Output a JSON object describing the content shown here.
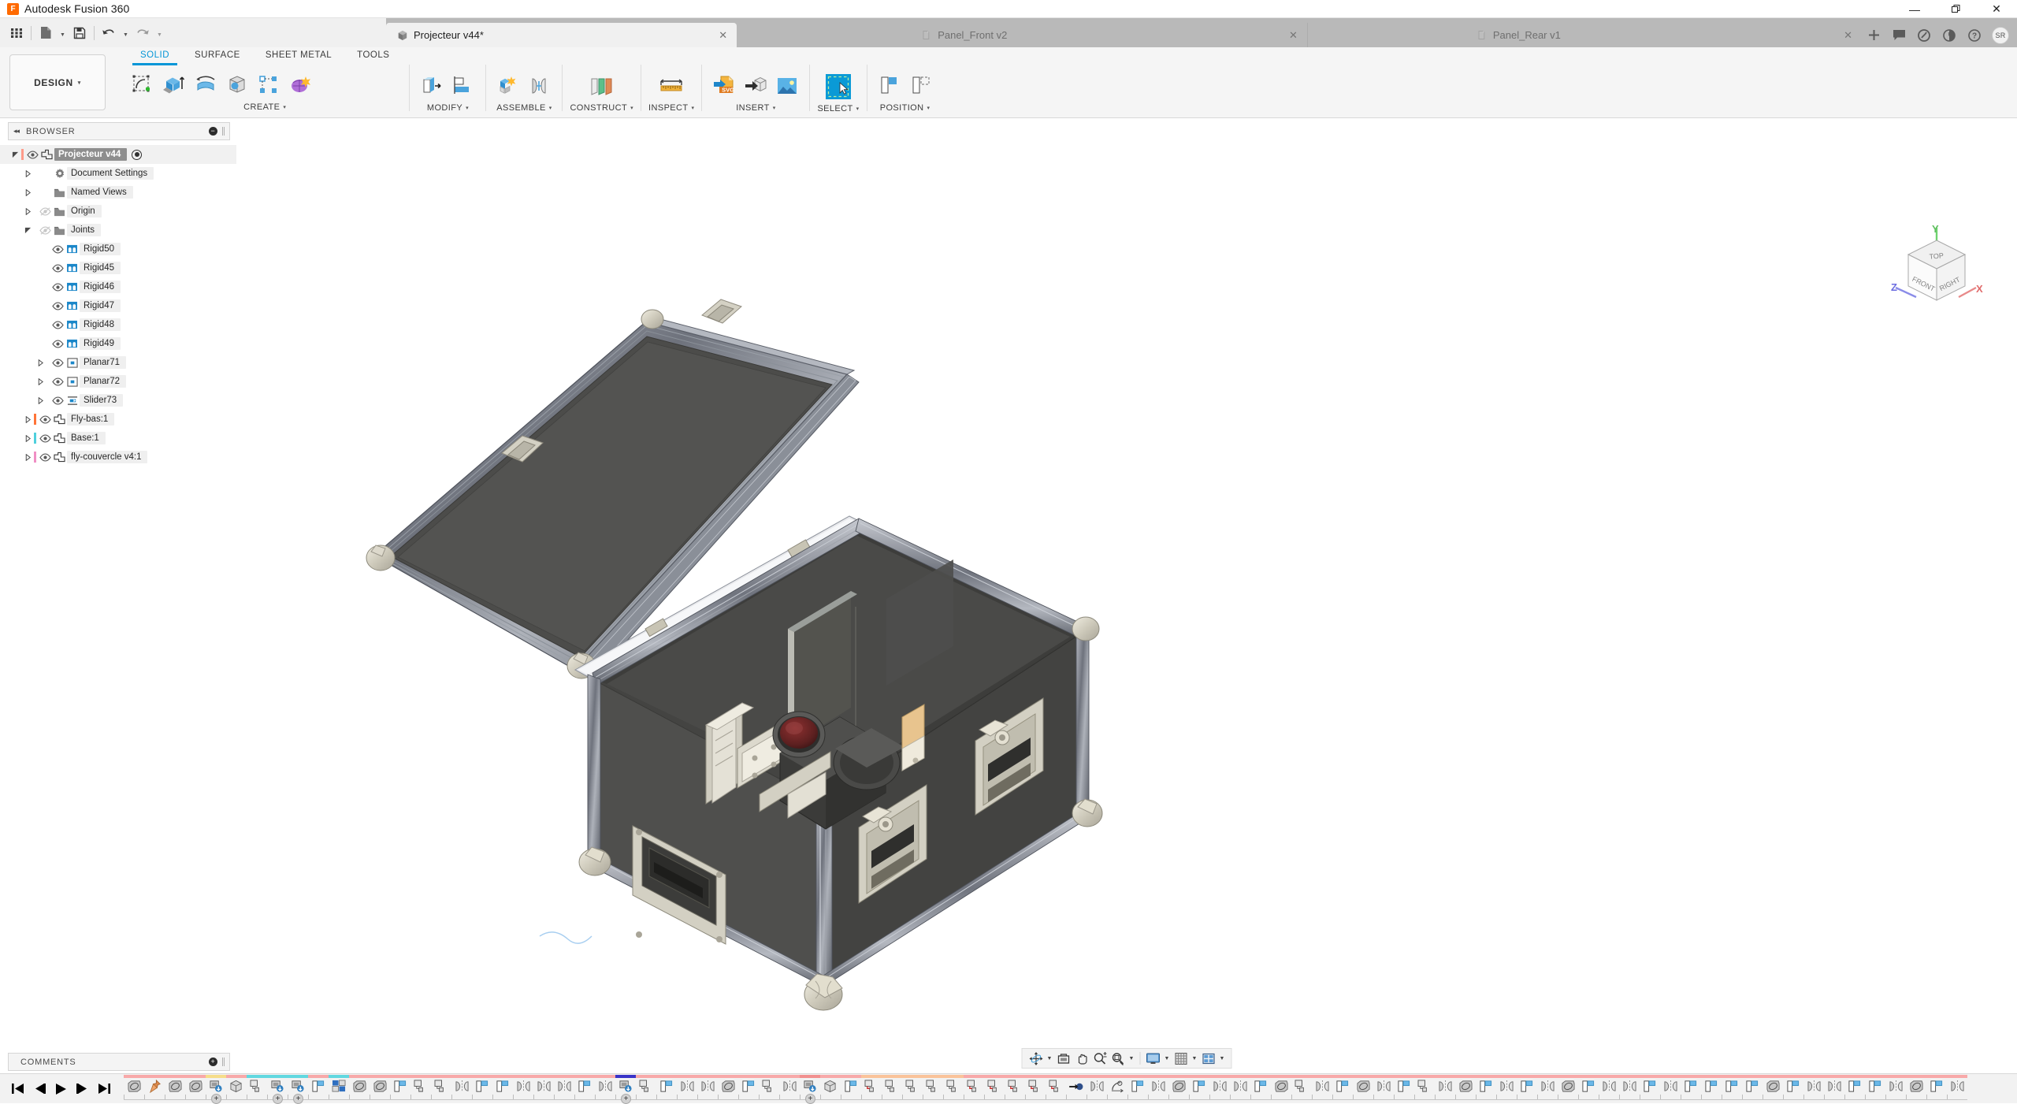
{
  "window": {
    "app_title": "Autodesk Fusion 360",
    "logo_text": "F",
    "minimize": "—",
    "restore": "❐",
    "close": "✕"
  },
  "quick_access": {
    "items": [
      {
        "name": "app-grid-icon",
        "label": "Show Data Panel"
      },
      {
        "name": "file-icon",
        "label": "File"
      },
      {
        "name": "save-icon",
        "label": "Save"
      },
      {
        "name": "undo-icon",
        "label": "Undo"
      },
      {
        "name": "redo-icon",
        "label": "Redo"
      }
    ]
  },
  "document_tabs": [
    {
      "label": "Projecteur v44*",
      "active": true,
      "icon": "solid-body-icon",
      "close": "✕"
    },
    {
      "label": "Panel_Front v2",
      "active": false,
      "icon": "sheet-metal-icon",
      "close": "✕"
    },
    {
      "label": "Panel_Rear v1",
      "active": false,
      "icon": "sheet-metal-icon",
      "close": "✕"
    }
  ],
  "tab_actions": [
    {
      "name": "new-tab-button",
      "glyph": "+"
    },
    {
      "name": "comments-icon",
      "glyph": "☰"
    },
    {
      "name": "notifications-icon",
      "glyph": "◑"
    },
    {
      "name": "recent-icon",
      "glyph": "◔"
    },
    {
      "name": "help-icon",
      "glyph": "?"
    }
  ],
  "avatar": "SR",
  "ribbon": {
    "workspace": "DESIGN",
    "workspace_caret": "▾",
    "tabs": [
      {
        "label": "SOLID",
        "selected": true
      },
      {
        "label": "SURFACE",
        "selected": false
      },
      {
        "label": "SHEET METAL",
        "selected": false
      },
      {
        "label": "TOOLS",
        "selected": false
      }
    ],
    "groups": [
      {
        "label": "CREATE",
        "caret": "▾",
        "icons": [
          "create-sketch-icon",
          "extrude-icon",
          "revolve-icon",
          "sweep-icon",
          "pattern-icon",
          "mesh-icon"
        ]
      },
      {
        "label": "MODIFY",
        "caret": "▾",
        "icons": [
          "press-pull-icon",
          "align-icon"
        ]
      },
      {
        "label": "ASSEMBLE",
        "caret": "▾",
        "icons": [
          "new-component-icon",
          "joint-icon"
        ]
      },
      {
        "label": "CONSTRUCT",
        "caret": "▾",
        "icons": [
          "offset-plane-icon"
        ]
      },
      {
        "label": "INSPECT",
        "caret": "▾",
        "icons": [
          "measure-icon"
        ]
      },
      {
        "label": "INSERT",
        "caret": "▾",
        "icons": [
          "insert-svg-icon",
          "insert-derive-icon",
          "decal-icon"
        ]
      },
      {
        "label": "SELECT",
        "caret": "▾",
        "icons": [
          "select-window-icon"
        ]
      },
      {
        "label": "POSITION",
        "caret": "▾",
        "icons": [
          "position-move-icon",
          "position-copy-icon"
        ]
      }
    ]
  },
  "browser": {
    "title": "BROWSER",
    "collapse_glyph": "◂◂",
    "add_glyph": "−",
    "tree": [
      {
        "label": "Projecteur v44",
        "indent": 0,
        "arrow": "expanded",
        "eye": "on",
        "icon": "component-icon",
        "bar": "#ff9b8a",
        "root": true,
        "radio": true
      },
      {
        "label": "Document Settings",
        "indent": 1,
        "arrow": "collapsed",
        "eye": "none",
        "icon": "gear-icon"
      },
      {
        "label": "Named Views",
        "indent": 1,
        "arrow": "collapsed",
        "eye": "none",
        "icon": "folder-icon"
      },
      {
        "label": "Origin",
        "indent": 1,
        "arrow": "collapsed",
        "eye": "off",
        "icon": "folder-icon"
      },
      {
        "label": "Joints",
        "indent": 1,
        "arrow": "expanded",
        "eye": "off",
        "icon": "folder-icon"
      },
      {
        "label": "Rigid50",
        "indent": 2,
        "arrow": "none",
        "eye": "on",
        "icon": "rigid-joint-icon"
      },
      {
        "label": "Rigid45",
        "indent": 2,
        "arrow": "none",
        "eye": "on",
        "icon": "rigid-joint-icon"
      },
      {
        "label": "Rigid46",
        "indent": 2,
        "arrow": "none",
        "eye": "on",
        "icon": "rigid-joint-icon"
      },
      {
        "label": "Rigid47",
        "indent": 2,
        "arrow": "none",
        "eye": "on",
        "icon": "rigid-joint-icon"
      },
      {
        "label": "Rigid48",
        "indent": 2,
        "arrow": "none",
        "eye": "on",
        "icon": "rigid-joint-icon"
      },
      {
        "label": "Rigid49",
        "indent": 2,
        "arrow": "none",
        "eye": "on",
        "icon": "rigid-joint-icon"
      },
      {
        "label": "Planar71",
        "indent": 2,
        "arrow": "collapsed",
        "eye": "on",
        "icon": "planar-joint-icon"
      },
      {
        "label": "Planar72",
        "indent": 2,
        "arrow": "collapsed",
        "eye": "on",
        "icon": "planar-joint-icon"
      },
      {
        "label": "Slider73",
        "indent": 2,
        "arrow": "collapsed",
        "eye": "on",
        "icon": "slider-joint-icon"
      },
      {
        "label": "Fly-bas:1",
        "indent": 1,
        "arrow": "collapsed",
        "eye": "on",
        "icon": "component-icon",
        "bar": "#ff7438"
      },
      {
        "label": "Base:1",
        "indent": 1,
        "arrow": "collapsed",
        "eye": "on",
        "icon": "component-icon",
        "bar": "#4fd0dd"
      },
      {
        "label": "fly-couvercle v4:1",
        "indent": 1,
        "arrow": "collapsed",
        "eye": "on",
        "icon": "component-icon",
        "bar": "#f08fc4"
      }
    ]
  },
  "comments": {
    "title": "COMMENTS",
    "add_glyph": "+"
  },
  "viewcube": {
    "top_face": "TOP",
    "front_face": "FRONT",
    "right_face": "RIGHT",
    "axis_x": "X",
    "axis_y": "Y",
    "axis_z": "Z"
  },
  "navbar": [
    {
      "name": "orbit-icon",
      "caret": true
    },
    {
      "name": "look-at-icon",
      "caret": false
    },
    {
      "name": "pan-icon",
      "caret": false
    },
    {
      "name": "zoom-icon",
      "caret": false
    },
    {
      "name": "zoom-window-icon",
      "caret": true
    },
    {
      "name": "display-settings-icon",
      "caret": true
    },
    {
      "name": "grid-snaps-icon",
      "caret": true
    },
    {
      "name": "viewports-icon",
      "caret": true
    }
  ],
  "timeline": {
    "playback": [
      {
        "name": "go-to-beginning-button",
        "glyph": "⏮"
      },
      {
        "name": "step-back-button",
        "glyph": "⏴"
      },
      {
        "name": "play-button",
        "glyph": "▶"
      },
      {
        "name": "step-forward-button",
        "glyph": "⏵"
      },
      {
        "name": "go-to-end-button",
        "glyph": "⏭"
      }
    ],
    "features": [
      {
        "g": "sketch",
        "b": "#f8a9a9"
      },
      {
        "g": "pin",
        "b": "#f8a9a9"
      },
      {
        "g": "sketch",
        "b": "#f8a9a9"
      },
      {
        "g": "sketch",
        "b": "#f8a9a9"
      },
      {
        "g": "insert",
        "b": "#f6dd8a",
        "plus": true
      },
      {
        "g": "cube",
        "b": "#f8a9a9"
      },
      {
        "g": "copy",
        "b": "#62d8e0"
      },
      {
        "g": "insert",
        "b": "#62d8e0",
        "plus": true
      },
      {
        "g": "insert",
        "b": "#62d8e0",
        "plus": true
      },
      {
        "g": "extrude",
        "b": "#f8a9a9"
      },
      {
        "g": "assem",
        "b": "#62d8e0"
      },
      {
        "g": "sketch",
        "b": "#f8a9a9"
      },
      {
        "g": "sketch",
        "b": "#f8a9a9"
      },
      {
        "g": "extrude",
        "b": "#f8a9a9"
      },
      {
        "g": "copy",
        "b": "#f8a9a9"
      },
      {
        "g": "copy",
        "b": "#f8a9a9"
      },
      {
        "g": "mirror",
        "b": "#f8a9a9"
      },
      {
        "g": "extrude",
        "b": "#f8a9a9"
      },
      {
        "g": "extrude",
        "b": "#f8a9a9"
      },
      {
        "g": "mirror",
        "b": "#f8a9a9"
      },
      {
        "g": "mirror",
        "b": "#f8a9a9"
      },
      {
        "g": "mirror",
        "b": "#f8a9a9"
      },
      {
        "g": "extrude",
        "b": "#f8a9a9"
      },
      {
        "g": "mirror",
        "b": "#f8a9a9"
      },
      {
        "g": "insert",
        "b": "#3a34c8",
        "plus": true
      },
      {
        "g": "copy",
        "b": "#f8a9a9"
      },
      {
        "g": "extrude",
        "b": "#f8a9a9"
      },
      {
        "g": "mirror",
        "b": "#f8a9a9"
      },
      {
        "g": "mirror",
        "b": "#f8a9a9"
      },
      {
        "g": "sketch",
        "b": "#f8a9a9"
      },
      {
        "g": "extrude",
        "b": "#f8a9a9"
      },
      {
        "g": "copy",
        "b": "#f8a9a9"
      },
      {
        "g": "mirror",
        "b": "#f8a9a9"
      },
      {
        "g": "insert",
        "b": "#f2908f",
        "plus": true
      },
      {
        "g": "cube",
        "b": "#f8a9a9"
      },
      {
        "g": "extrude",
        "b": "#f8a9a9"
      },
      {
        "g": "copyred",
        "b": "#fac39a"
      },
      {
        "g": "copy",
        "b": "#fac39a"
      },
      {
        "g": "copy",
        "b": "#fac39a"
      },
      {
        "g": "copy",
        "b": "#fac39a"
      },
      {
        "g": "copy",
        "b": "#fac39a"
      },
      {
        "g": "copyred",
        "b": "#f8a9a9"
      },
      {
        "g": "copyred",
        "b": "#f8a9a9"
      },
      {
        "g": "copyred",
        "b": "#f8a9a9"
      },
      {
        "g": "copyred",
        "b": "#f8a9a9"
      },
      {
        "g": "copyred",
        "b": "#f8a9a9"
      },
      {
        "g": "joint",
        "b": "#f8a9a9"
      },
      {
        "g": "mirror",
        "b": "#f8a9a9"
      },
      {
        "g": "rev",
        "b": "#f8a9a9"
      },
      {
        "g": "extrude",
        "b": "#f8a9a9"
      },
      {
        "g": "mirror",
        "b": "#f8a9a9"
      },
      {
        "g": "sketch",
        "b": "#f8a9a9"
      },
      {
        "g": "extrude",
        "b": "#f8a9a9"
      },
      {
        "g": "mirror",
        "b": "#f8a9a9"
      },
      {
        "g": "mirror",
        "b": "#f8a9a9"
      },
      {
        "g": "extrude",
        "b": "#f8a9a9"
      },
      {
        "g": "sketch",
        "b": "#f8a9a9"
      },
      {
        "g": "copy",
        "b": "#f8a9a9"
      },
      {
        "g": "mirror",
        "b": "#f8a9a9"
      },
      {
        "g": "extrude",
        "b": "#f8a9a9"
      },
      {
        "g": "sketch",
        "b": "#f8a9a9"
      },
      {
        "g": "mirror",
        "b": "#f8a9a9"
      },
      {
        "g": "extrude",
        "b": "#f8a9a9"
      },
      {
        "g": "copy",
        "b": "#f8a9a9"
      },
      {
        "g": "mirror",
        "b": "#f8a9a9"
      },
      {
        "g": "sketch",
        "b": "#f8a9a9"
      },
      {
        "g": "extrude",
        "b": "#f8a9a9"
      },
      {
        "g": "mirror",
        "b": "#f8a9a9"
      },
      {
        "g": "extrude",
        "b": "#f8a9a9"
      },
      {
        "g": "mirror",
        "b": "#f8a9a9"
      },
      {
        "g": "sketch",
        "b": "#f8a9a9"
      },
      {
        "g": "extrude",
        "b": "#f8a9a9"
      },
      {
        "g": "mirror",
        "b": "#f8a9a9"
      },
      {
        "g": "mirror",
        "b": "#f8a9a9"
      },
      {
        "g": "extrude",
        "b": "#f8a9a9"
      },
      {
        "g": "mirror",
        "b": "#f8a9a9"
      },
      {
        "g": "extrude",
        "b": "#f8a9a9"
      },
      {
        "g": "extrude",
        "b": "#f8a9a9"
      },
      {
        "g": "extrude",
        "b": "#f8a9a9"
      },
      {
        "g": "extrude",
        "b": "#f8a9a9"
      },
      {
        "g": "sketch",
        "b": "#f8a9a9"
      },
      {
        "g": "extrude",
        "b": "#f8a9a9"
      },
      {
        "g": "mirror",
        "b": "#f8a9a9"
      },
      {
        "g": "mirror",
        "b": "#f8a9a9"
      },
      {
        "g": "extrude",
        "b": "#f8a9a9"
      },
      {
        "g": "extrude",
        "b": "#f8a9a9"
      },
      {
        "g": "mirror",
        "b": "#f8a9a9"
      },
      {
        "g": "sketch",
        "b": "#f8a9a9"
      },
      {
        "g": "extrude",
        "b": "#f8a9a9"
      },
      {
        "g": "mirror",
        "b": "#f8a9a9"
      }
    ]
  },
  "model": {
    "description": "Isometric 3D view of an open flight case (road case) containing a projector on a mounting rail",
    "body_color": "#4a4a48",
    "frame_color": "#7d8189",
    "hardware_color": "#d8d5c8",
    "lens_color": "#6b2b2b"
  }
}
